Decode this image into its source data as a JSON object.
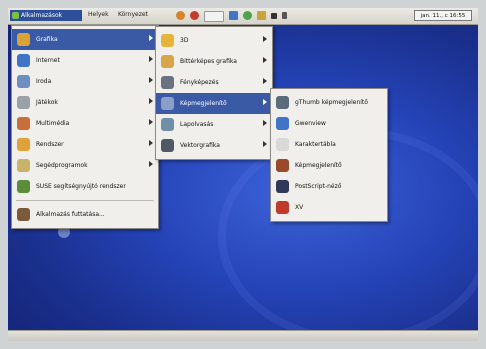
{
  "topbar": {
    "apps_button": "Alkalmazások",
    "menus": [
      "Helyek",
      "Környezet"
    ],
    "clock": "jan. 11., c 16:55"
  },
  "main_menu": [
    {
      "label": "Grafika",
      "icon": "graphics-icon",
      "color": "#d8a43a",
      "submenu": true,
      "selected": true
    },
    {
      "label": "Internet",
      "icon": "globe-icon",
      "color": "#3f74c9",
      "submenu": true
    },
    {
      "label": "Iroda",
      "icon": "office-icon",
      "color": "#6e8fbf",
      "submenu": true
    },
    {
      "label": "Játékok",
      "icon": "games-icon",
      "color": "#9aa0a8",
      "submenu": true
    },
    {
      "label": "Multimédia",
      "icon": "multimedia-icon",
      "color": "#c66f3a",
      "submenu": true
    },
    {
      "label": "Rendszer",
      "icon": "system-icon",
      "color": "#e0a23a",
      "submenu": true
    },
    {
      "label": "Segédprogramok",
      "icon": "utilities-icon",
      "color": "#c9b26a",
      "submenu": true
    },
    {
      "label": "SUSE segítségnyújtó rendszer",
      "icon": "help-icon",
      "color": "#5b8d3a",
      "submenu": false
    },
    {
      "label": "Alkalmazás futtatása...",
      "icon": "run-icon",
      "color": "#7a5a3a",
      "submenu": false
    }
  ],
  "graphics_menu": [
    {
      "label": "3D",
      "icon": "3d-icon",
      "color": "#e7b43b",
      "submenu": true
    },
    {
      "label": "Bittérképes grafika",
      "icon": "paint-icon",
      "color": "#d8a64a",
      "submenu": true
    },
    {
      "label": "Fényképezés",
      "icon": "camera-icon",
      "color": "#6b7280",
      "submenu": true
    },
    {
      "label": "Képmegjelenítő",
      "icon": "image-viewer-icon",
      "color": "#8aa0c8",
      "submenu": true,
      "selected": true
    },
    {
      "label": "Lapolvasás",
      "icon": "scanner-icon",
      "color": "#6f8fa8",
      "submenu": true
    },
    {
      "label": "Vektorgrafika",
      "icon": "vector-icon",
      "color": "#505a66",
      "submenu": true
    }
  ],
  "viewer_menu": [
    {
      "label": "gThumb képmegjelenítő",
      "icon": "gthumb-icon",
      "color": "#5a6c7c"
    },
    {
      "label": "Gwenview",
      "icon": "gwenview-icon",
      "color": "#3f74c9"
    },
    {
      "label": "Karaktertábla",
      "icon": "charmap-icon",
      "color": "#d9d9d9"
    },
    {
      "label": "Képmegjelenítő",
      "icon": "eog-icon",
      "color": "#9a4a2a"
    },
    {
      "label": "PostScript-néző",
      "icon": "postscript-icon",
      "color": "#2f3a5a"
    },
    {
      "label": "XV",
      "icon": "xv-icon",
      "color": "#c0392b"
    }
  ]
}
